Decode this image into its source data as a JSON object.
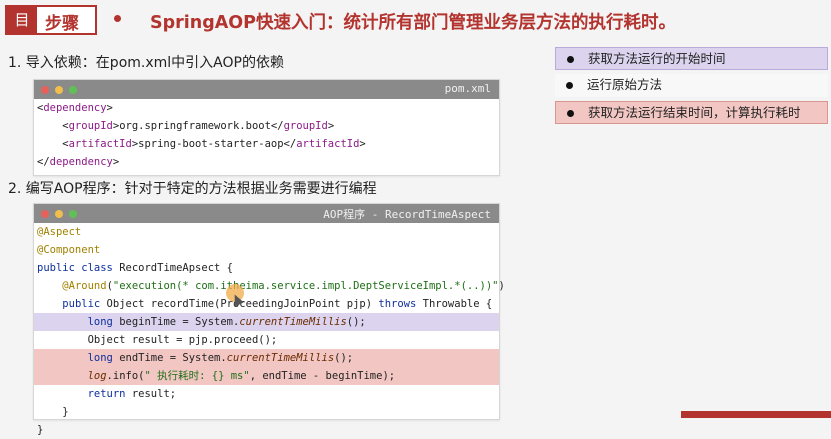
{
  "header": {
    "step_icon": "目",
    "step_label": "步骤",
    "title": "SpringAOP快速入门：统计所有部门管理业务层方法的执行耗时。"
  },
  "section1": {
    "title": "1. 导入依赖：在pom.xml中引入AOP的依赖",
    "codebox_title": "pom.xml",
    "lines": [
      [
        "<",
        "dependency",
        ">"
      ],
      [
        "    <",
        "groupId",
        ">org.springframework.boot</",
        "groupId",
        ">"
      ],
      [
        "    <",
        "artifactId",
        ">spring-boot-starter-aop</",
        "artifactId",
        ">"
      ],
      [
        "</",
        "dependency",
        ">"
      ]
    ]
  },
  "section2": {
    "title": "2. 编写AOP程序：针对于特定的方法根据业务需要进行编程",
    "codebox_title": "AOP程序 - RecordTimeAspect"
  },
  "legend": [
    {
      "text": "获取方法运行的开始时间",
      "color": "#dcd4ef"
    },
    {
      "text": "运行原始方法",
      "color": "#f8f8f8"
    },
    {
      "text": "获取方法运行结束时间，计算执行耗时",
      "color": "#f2c7c3"
    }
  ],
  "code": {
    "a1": "@Aspect",
    "a2": "@Component",
    "l3_kw1": "public",
    "l3_kw2": "class",
    "l3_rest": " RecordTimeApsect {",
    "l4_ann": "@Around",
    "l4_open": "(",
    "l4_str": "\"execution(* com.itheima.service.impl.DeptServiceImpl.*(..))\"",
    "l4_close": ")",
    "l5_kw": "public",
    "l5_mid": " Object recordTime(ProceedingJoinPoint pjp) ",
    "l5_kw2": "throws",
    "l5_end": " Throwable {",
    "l6_kw": "long",
    "l6_mid": " beginTime = System.",
    "l6_ital": "currentTimeMillis",
    "l6_end": "();",
    "l7": "Object result = pjp.proceed();",
    "l8_kw": "long",
    "l8_mid": " endTime = System.",
    "l8_ital": "currentTimeMillis",
    "l8_end": "();",
    "l9_ital": "log",
    "l9_mid": ".info(",
    "l9_str": "\" 执行耗时: {} ms\"",
    "l9_end": ", endTime - beginTime);",
    "l10_kw": "return",
    "l10_end": " result;",
    "l11": "}",
    "l12": "}"
  }
}
